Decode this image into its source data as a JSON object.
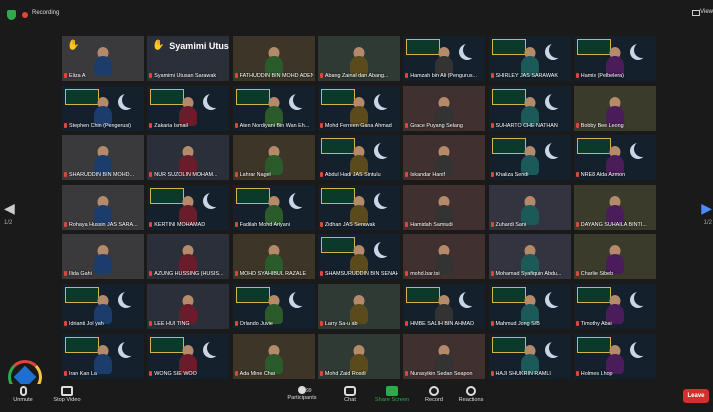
{
  "topbar": {
    "recording_label": "Recording",
    "view_label": "View"
  },
  "nav": {
    "left_page": "1/2",
    "right_page": "1/2"
  },
  "tiles": [
    {
      "name": "Eliza A",
      "kind": "hand_small"
    },
    {
      "name": "Syamimi Utusan Sarawak",
      "kind": "hand_big",
      "big": "Syamimi Utusan..."
    },
    {
      "name": "FATHUDDIN BIN MOHD ADEN",
      "kind": "active"
    },
    {
      "name": "Abang Zainal dan Abang...",
      "kind": "person"
    },
    {
      "name": "Hamzah bin Ali (Pengurus...",
      "kind": "banner"
    },
    {
      "name": "SHIRLEY JAS SARAWAK",
      "kind": "banner"
    },
    {
      "name": "Hamis (Pelbelera)",
      "kind": "banner"
    },
    {
      "name": "Stephen Chin (Pengerusi)",
      "kind": "banner"
    },
    {
      "name": "Zakaria Ismail",
      "kind": "banner"
    },
    {
      "name": "Aten Nordiyani Bin Wan Eh...",
      "kind": "banner"
    },
    {
      "name": "Mohd Ferreen Gana Ahmad",
      "kind": "banner"
    },
    {
      "name": "Grace Puyang Selang",
      "kind": "person"
    },
    {
      "name": "SUHARTO CHE NATHAN",
      "kind": "banner"
    },
    {
      "name": "Bobby Bee Leong",
      "kind": "person"
    },
    {
      "name": "SHARUDDIN BIN MOHD...",
      "kind": "person"
    },
    {
      "name": "NUR SUZOLIN MOHAM...",
      "kind": "person"
    },
    {
      "name": "Lahrar Nagel",
      "kind": "person"
    },
    {
      "name": "Abdul Hadi JAS Sintulu",
      "kind": "banner"
    },
    {
      "name": "Iskandar Hanif",
      "kind": "person"
    },
    {
      "name": "Khaliza Sendi",
      "kind": "banner"
    },
    {
      "name": "NRE8 Alda Azmon",
      "kind": "banner"
    },
    {
      "name": "Rohaya Hussin JAS SARA...",
      "kind": "person"
    },
    {
      "name": "KERTINI MOHAMAD",
      "kind": "banner"
    },
    {
      "name": "Fadilah Mohd Ariyani",
      "kind": "banner"
    },
    {
      "name": "Zidhan JAS Serawak",
      "kind": "banner"
    },
    {
      "name": "Hamidah Samiudi",
      "kind": "person"
    },
    {
      "name": "Zuhardi Sani",
      "kind": "person"
    },
    {
      "name": "DAYANG SUHAILA BINTI...",
      "kind": "person"
    },
    {
      "name": "Ilida Gahi",
      "kind": "person"
    },
    {
      "name": "AZUNG HUSSING (HUSIS...",
      "kind": "person"
    },
    {
      "name": "MOHD SYAHIBUL RAZALE",
      "kind": "person"
    },
    {
      "name": "SHAMSURUDDIN BIN SENAH",
      "kind": "banner"
    },
    {
      "name": "mohd.bar.tsi",
      "kind": "person"
    },
    {
      "name": "Mohamad Syafiquin Abdu...",
      "kind": "person"
    },
    {
      "name": "Charlie Sibeb",
      "kind": "person"
    },
    {
      "name": "Idrianti Jol yah",
      "kind": "banner"
    },
    {
      "name": "LEE HUI TING",
      "kind": "person"
    },
    {
      "name": "Orlando Juvie",
      "kind": "banner"
    },
    {
      "name": "Larry Sa-u ab",
      "kind": "person"
    },
    {
      "name": "HMBE SALIH BIN AHMAD",
      "kind": "banner"
    },
    {
      "name": "Mahmud Jong S/B",
      "kind": "banner"
    },
    {
      "name": "Timothy Abai",
      "kind": "banner"
    },
    {
      "name": "Iran Kan La",
      "kind": "banner"
    },
    {
      "name": "WONG SIE WOO",
      "kind": "banner"
    },
    {
      "name": "Ada Mine Chai",
      "kind": "person"
    },
    {
      "name": "Mohd Zaid Rosdi",
      "kind": "person"
    },
    {
      "name": "Nurasyikin Sedan Seapon",
      "kind": "person"
    },
    {
      "name": "HAJI SHUKRIN RAMLI",
      "kind": "banner"
    },
    {
      "name": "Holmes Lhop",
      "kind": "banner"
    }
  ],
  "toolbar": {
    "unmute": "Unmute",
    "stop_video": "Stop Video",
    "participants": "Participants",
    "participant_count": "99",
    "chat": "Chat",
    "share_screen": "Share Screen",
    "record": "Record",
    "reactions": "Reactions",
    "leave": "Leave"
  },
  "colors": {
    "accent": "#2eaa4a",
    "leave": "#d42e2e",
    "active_outline": "#c4d94a"
  }
}
